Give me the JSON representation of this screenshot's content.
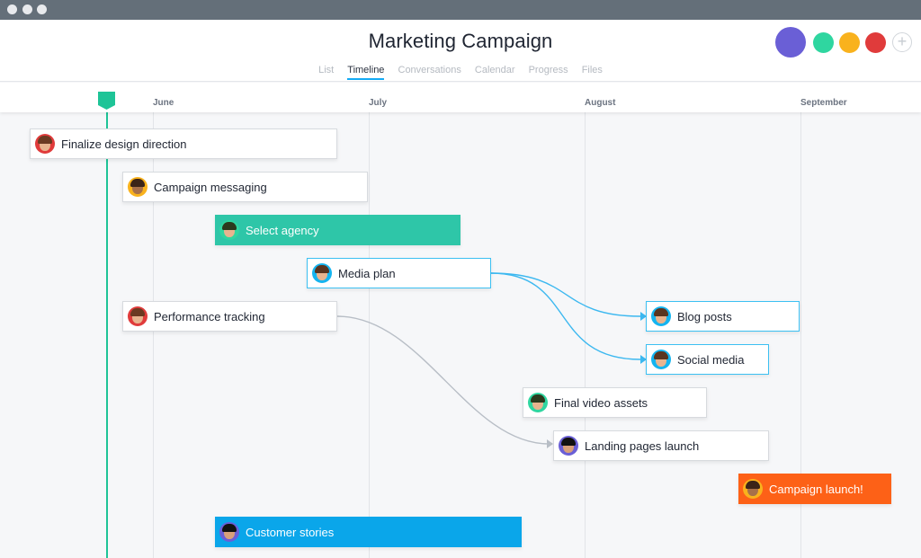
{
  "window": {
    "controls": [
      "close",
      "minimize",
      "maximize"
    ]
  },
  "header": {
    "title": "Marketing Campaign",
    "tabs": [
      {
        "label": "List",
        "active": false
      },
      {
        "label": "Timeline",
        "active": true
      },
      {
        "label": "Conversations",
        "active": false
      },
      {
        "label": "Calendar",
        "active": false
      },
      {
        "label": "Progress",
        "active": false
      },
      {
        "label": "Files",
        "active": false
      }
    ],
    "members": [
      {
        "name": "member-1",
        "ring": "#6a5fd6"
      },
      {
        "name": "member-2",
        "ring": "#2fd6a0"
      },
      {
        "name": "member-3",
        "ring": "#f9b21d"
      },
      {
        "name": "member-4",
        "ring": "#e03b3b"
      }
    ],
    "add_member_label": "+"
  },
  "timeline": {
    "months": [
      "June",
      "July",
      "August",
      "September"
    ],
    "today_marker_color": "#1ec497",
    "tasks": [
      {
        "label": "Finalize design direction",
        "assignee_ring": "#e03b3b",
        "style": "default"
      },
      {
        "label": "Campaign messaging",
        "assignee_ring": "#f9b21d",
        "style": "default"
      },
      {
        "label": "Select agency",
        "assignee_ring": "#2fd6a0",
        "style": "filled",
        "color": "#2ec6a8"
      },
      {
        "label": "Media plan",
        "assignee_ring": "#14b4f0",
        "style": "selected"
      },
      {
        "label": "Performance tracking",
        "assignee_ring": "#e03b3b",
        "style": "default"
      },
      {
        "label": "Blog posts",
        "assignee_ring": "#14b4f0",
        "style": "selected"
      },
      {
        "label": "Social media",
        "assignee_ring": "#14b4f0",
        "style": "selected"
      },
      {
        "label": "Final video assets",
        "assignee_ring": "#2fd6a0",
        "style": "default"
      },
      {
        "label": "Landing pages launch",
        "assignee_ring": "#6a5fd6",
        "style": "default"
      },
      {
        "label": "Campaign launch!",
        "assignee_ring": "#f9b21d",
        "style": "filled",
        "color": "#fd6117"
      },
      {
        "label": "Customer stories",
        "assignee_ring": "#6a5fd6",
        "style": "filled",
        "color": "#0aa6ea"
      }
    ],
    "dependencies": [
      {
        "from": "Media plan",
        "to": "Blog posts",
        "color": "#3cb8f0"
      },
      {
        "from": "Media plan",
        "to": "Social media",
        "color": "#3cb8f0"
      },
      {
        "from": "Performance tracking",
        "to": "Landing pages launch",
        "color": "#b8bec6"
      }
    ]
  }
}
